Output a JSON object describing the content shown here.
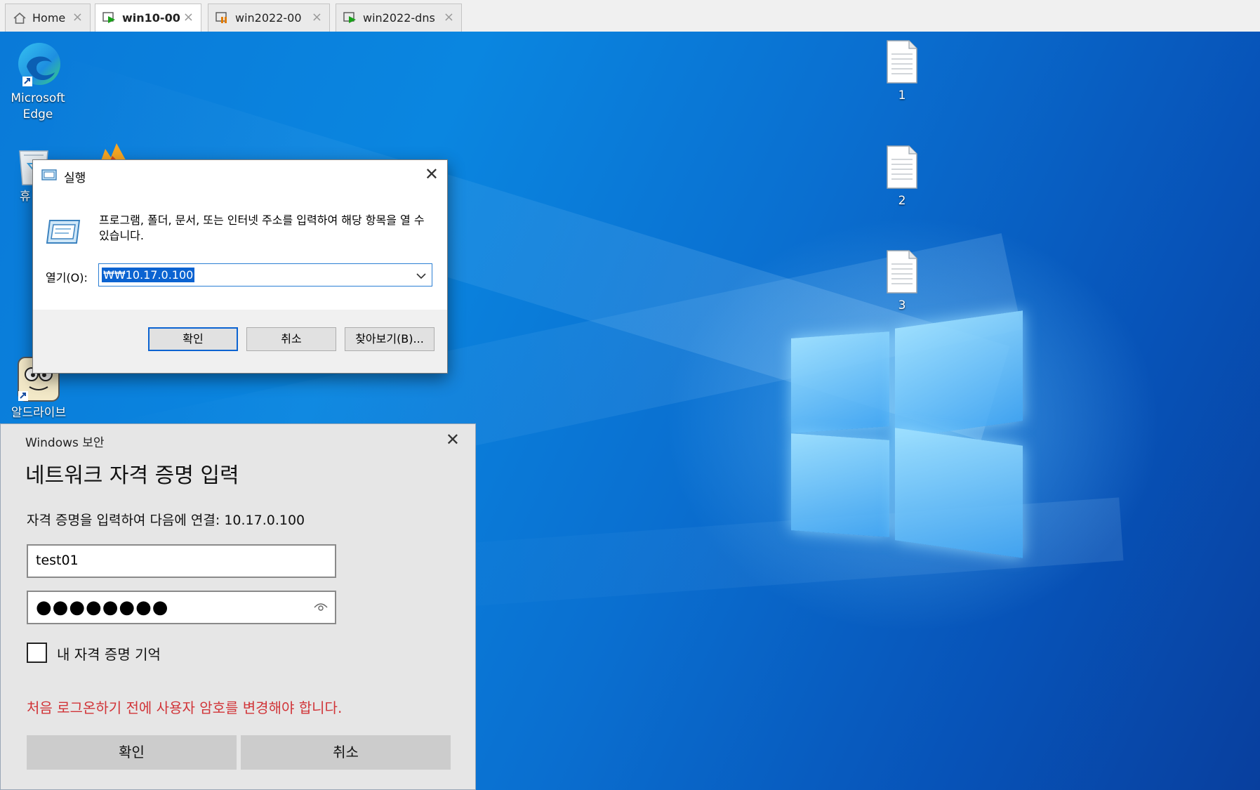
{
  "tabs": [
    {
      "label": "Home",
      "icon": "home-icon"
    },
    {
      "label": "win10-00",
      "icon": "vm-running-icon",
      "active": true
    },
    {
      "label": "win2022-00",
      "icon": "vm-paused-icon"
    },
    {
      "label": "win2022-dns",
      "icon": "vm-running-icon"
    }
  ],
  "tab_close": "×",
  "desktop": {
    "icons": {
      "edge": "Microsoft\nEdge",
      "edge_line1": "Microsoft",
      "edge_line2": "Edge",
      "recycle_partial": "휴",
      "aldrive": "알드라이브",
      "file1": "1",
      "file2": "2",
      "file3": "3"
    }
  },
  "run_dialog": {
    "title": "실행",
    "description": "프로그램, 폴더, 문서, 또는 인터넷 주소를 입력하여 해당 항목을 열 수 있습니다.",
    "open_label": "열기(O):",
    "open_value": "₩₩10.17.0.100",
    "ok": "확인",
    "cancel": "취소",
    "browse": "찾아보기(B)...",
    "close": "✕"
  },
  "security_dialog": {
    "caption": "Windows 보안",
    "heading": "네트워크 자격 증명 입력",
    "prompt": "자격 증명을 입력하여 다음에 연결: 10.17.0.100",
    "username": "test01",
    "password_mask": "●●●●●●●●",
    "remember_label": "내 자격 증명 기억",
    "remember_checked": false,
    "error": "처음 로그온하기 전에 사용자 암호를 변경해야 합니다.",
    "ok": "확인",
    "cancel": "취소",
    "close": "✕"
  },
  "colors": {
    "error_red": "#d13438",
    "selection_blue": "#0b63d1",
    "desktop_blue": "#0a7ad8"
  }
}
